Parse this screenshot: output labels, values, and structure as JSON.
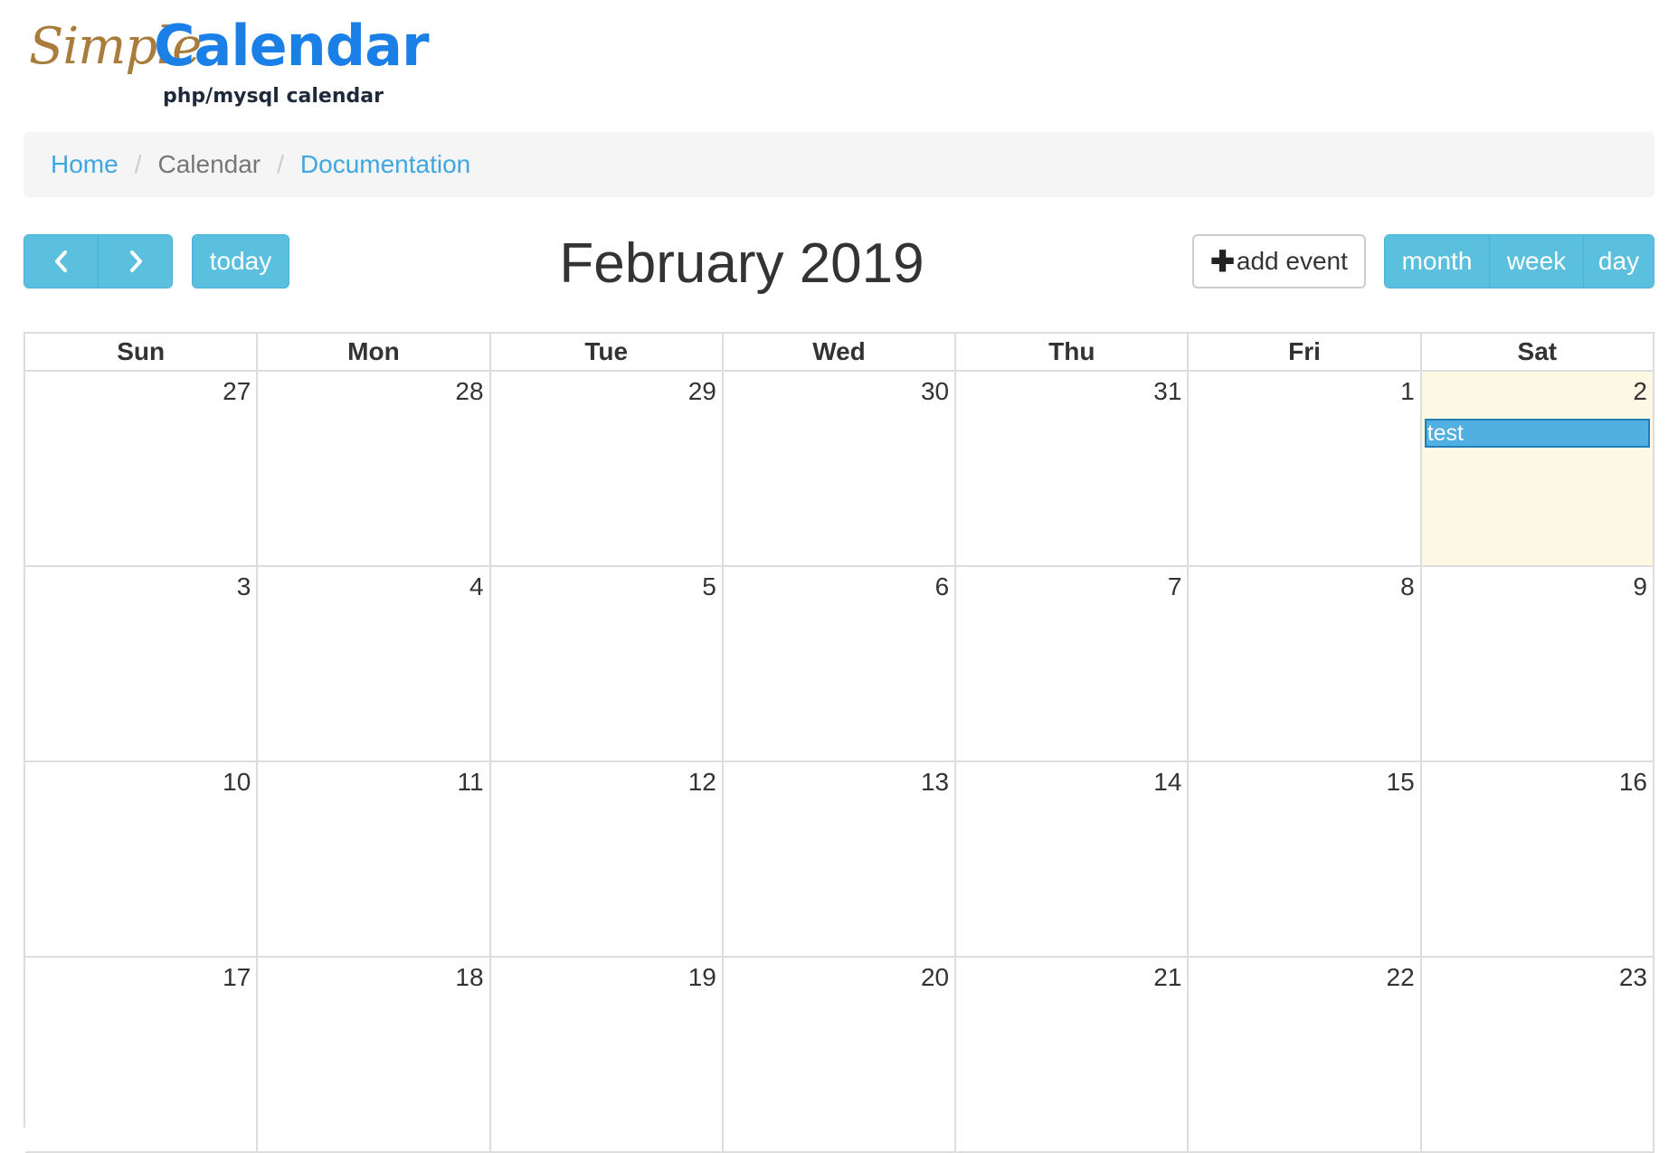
{
  "logo": {
    "simple": "Simple",
    "calendar": "Calendar",
    "subtitle": "php/mysql calendar"
  },
  "breadcrumb": {
    "items": [
      "Home",
      "Calendar",
      "Documentation"
    ],
    "separator": "/"
  },
  "toolbar": {
    "prev_icon": "chevron-left-icon",
    "next_icon": "chevron-right-icon",
    "today_label": "today",
    "title": "February 2019",
    "add_event_label": "add event",
    "views": [
      "month",
      "week",
      "day"
    ],
    "accent_color": "#5bc0de"
  },
  "calendar": {
    "weekdays": [
      "Sun",
      "Mon",
      "Tue",
      "Wed",
      "Thu",
      "Fri",
      "Sat"
    ],
    "weeks": [
      [
        "27",
        "28",
        "29",
        "30",
        "31",
        "1",
        "2"
      ],
      [
        "3",
        "4",
        "5",
        "6",
        "7",
        "8",
        "9"
      ],
      [
        "10",
        "11",
        "12",
        "13",
        "14",
        "15",
        "16"
      ],
      [
        "17",
        "18",
        "19",
        "20",
        "21",
        "22",
        "23"
      ]
    ],
    "today_highlight_color": "#fcf8e3",
    "events": [
      {
        "title": "test",
        "date": "2",
        "color": "#51afe2"
      }
    ]
  }
}
